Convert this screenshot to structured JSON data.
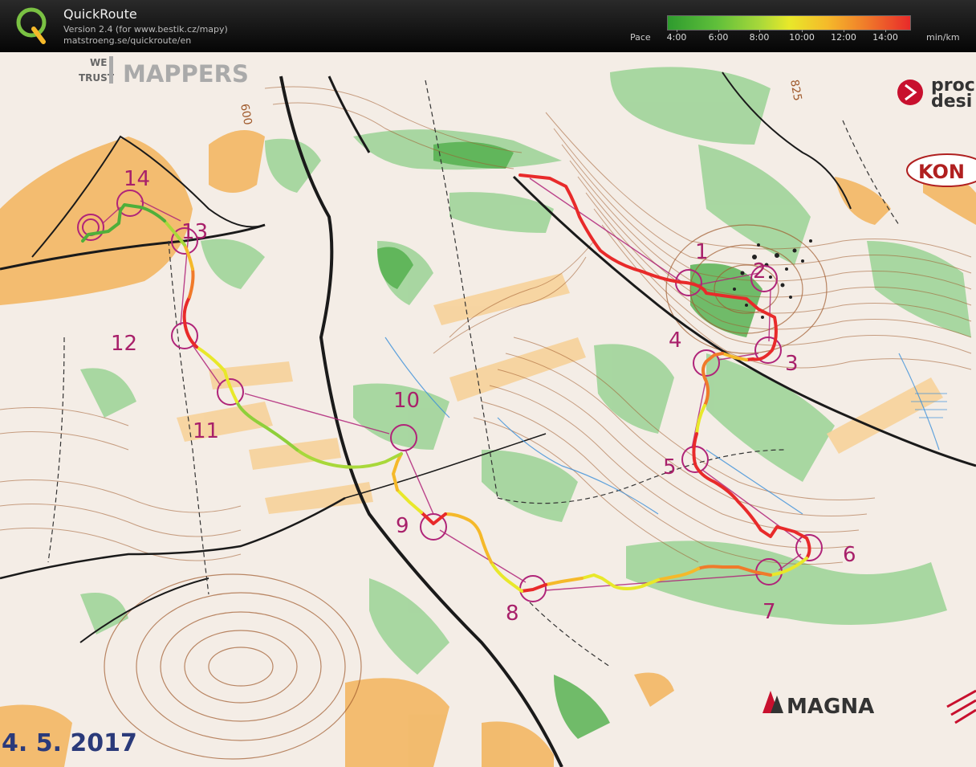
{
  "app": {
    "title": "QuickRoute",
    "version": "Version 2.4  (for www.bestik.cz/mapy)",
    "url": "matstroeng.se/quickroute/en",
    "logo_letter": "Q"
  },
  "pace_scale": {
    "label": "Pace",
    "unit": "min/km",
    "ticks": [
      "4:00",
      "6:00",
      "8:00",
      "10:00",
      "12:00",
      "14:00"
    ],
    "colors": [
      "#2e9b2e",
      "#a8d83a",
      "#e8e82a",
      "#f5b92a",
      "#f07a2a",
      "#e82a2a"
    ]
  },
  "map": {
    "controls": [
      "1",
      "2",
      "3",
      "4",
      "5",
      "6",
      "7",
      "8",
      "9",
      "10",
      "11",
      "12",
      "13",
      "14"
    ],
    "contour_label_1": "600",
    "contour_label_2": "825",
    "date_text": "4. 5. 2017",
    "sponsors": {
      "we": "WE",
      "trust": "TRUST",
      "mappers": "MAPPERS",
      "proc": "proc",
      "desi": "desi",
      "kon": "KON",
      "magna": "MAGNA"
    }
  }
}
